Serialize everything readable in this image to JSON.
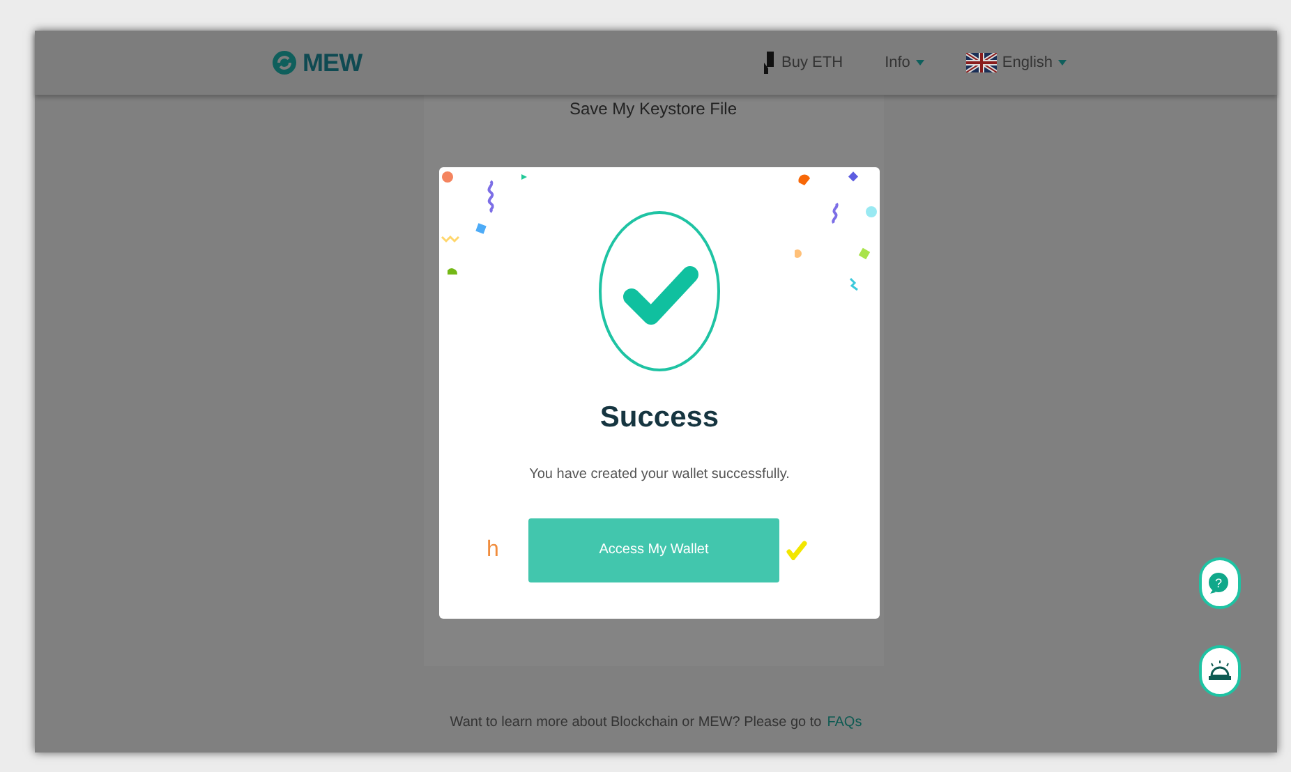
{
  "header": {
    "logo": "MEW",
    "nav": [
      {
        "label": "Buy ETH",
        "kind": "link"
      },
      {
        "label": "Info",
        "kind": "dropdown"
      },
      {
        "label": "English",
        "kind": "language"
      }
    ]
  },
  "page": {
    "title": "Save My Keystore File",
    "footer": {
      "text": "Want to learn more about Blockchain or MEW? Please go to",
      "link": "FAQs"
    }
  },
  "modal": {
    "title": "Success",
    "message": "You have created your wallet successfully.",
    "button": "Access My Wallet",
    "side_mark": "h"
  },
  "help_button": {
    "glyph": "?"
  }
}
